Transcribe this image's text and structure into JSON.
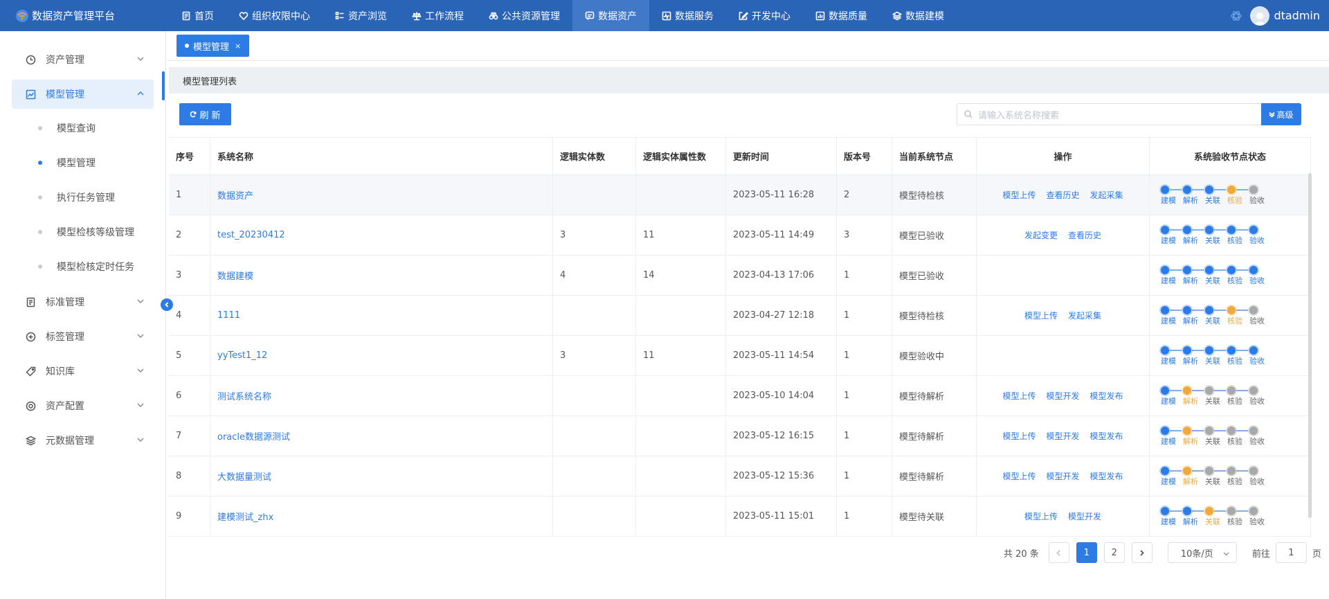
{
  "app": {
    "title": "数据资产管理平台",
    "username": "dtadmin"
  },
  "nav": [
    {
      "label": "首页",
      "icon": "document-icon",
      "active": false
    },
    {
      "label": "组织权限中心",
      "icon": "heart-icon",
      "active": false
    },
    {
      "label": "资产浏览",
      "icon": "list-icon",
      "active": false
    },
    {
      "label": "工作流程",
      "icon": "scale-icon",
      "active": false
    },
    {
      "label": "公共资源管理",
      "icon": "binoculars-icon",
      "active": false
    },
    {
      "label": "数据资产",
      "icon": "chat-icon",
      "active": true
    },
    {
      "label": "数据服务",
      "icon": "pulse-icon",
      "active": false
    },
    {
      "label": "开发中心",
      "icon": "edit-icon",
      "active": false
    },
    {
      "label": "数据质量",
      "icon": "chart-icon",
      "active": false
    },
    {
      "label": "数据建模",
      "icon": "layers-icon",
      "active": false
    }
  ],
  "sidebar": {
    "items": [
      {
        "label": "资产管理",
        "icon": "clock-icon"
      },
      {
        "label": "模型管理",
        "icon": "trend-chart-icon"
      },
      {
        "label": "标准管理",
        "icon": "notebook-icon"
      },
      {
        "label": "标签管理",
        "icon": "plus-circle-icon"
      },
      {
        "label": "知识库",
        "icon": "tag-icon"
      },
      {
        "label": "资产配置",
        "icon": "target-icon"
      },
      {
        "label": "元数据管理",
        "icon": "stack-icon"
      }
    ],
    "subitems": [
      {
        "label": "模型查询",
        "active": false
      },
      {
        "label": "模型管理",
        "active": true
      },
      {
        "label": "执行任务管理",
        "active": false
      },
      {
        "label": "模型检核等级管理",
        "active": false
      },
      {
        "label": "模型检核定时任务",
        "active": false
      }
    ]
  },
  "tabs": [
    {
      "label": "模型管理",
      "close": "×"
    }
  ],
  "panel": {
    "title": "模型管理列表",
    "refresh_label": "刷 新",
    "search_placeholder": "请输入系统名称搜索",
    "advanced_label": "高级"
  },
  "table": {
    "headers": [
      "序号",
      "系统名称",
      "逻辑实体数",
      "逻辑实体属性数",
      "更新时间",
      "版本号",
      "当前系统节点",
      "操作",
      "系统验收节点状态"
    ],
    "step_labels": [
      "建模",
      "解析",
      "关联",
      "核验",
      "验收"
    ],
    "rows": [
      {
        "no": "1",
        "name": "数据资产",
        "entities": "",
        "attrs": "",
        "time": "2023-05-11 16:28",
        "version": "2",
        "node": "模型待检核",
        "ops": [
          "模型上传",
          "查看历史",
          "发起采集"
        ],
        "steps": [
          "done",
          "done",
          "done",
          "current",
          "todo"
        ]
      },
      {
        "no": "2",
        "name": "test_20230412",
        "entities": "3",
        "attrs": "11",
        "time": "2023-05-11 14:49",
        "version": "3",
        "node": "模型已验收",
        "ops": [
          "发起变更",
          "查看历史"
        ],
        "steps": [
          "done",
          "done",
          "done",
          "done",
          "done"
        ]
      },
      {
        "no": "3",
        "name": "数据建模",
        "entities": "4",
        "attrs": "14",
        "time": "2023-04-13 17:06",
        "version": "1",
        "node": "模型已验收",
        "ops": [],
        "steps": [
          "done",
          "done",
          "done",
          "done",
          "done"
        ]
      },
      {
        "no": "4",
        "name": "1111",
        "entities": "",
        "attrs": "",
        "time": "2023-04-27 12:18",
        "version": "1",
        "node": "模型待检核",
        "ops": [
          "模型上传",
          "发起采集"
        ],
        "steps": [
          "done",
          "done",
          "done",
          "current",
          "todo"
        ]
      },
      {
        "no": "5",
        "name": "yyTest1_12",
        "entities": "3",
        "attrs": "11",
        "time": "2023-05-11 14:54",
        "version": "1",
        "node": "模型验收中",
        "ops": [],
        "steps": [
          "done",
          "done",
          "done",
          "done",
          "done"
        ]
      },
      {
        "no": "6",
        "name": "测试系统名称",
        "entities": "",
        "attrs": "",
        "time": "2023-05-10 14:04",
        "version": "1",
        "node": "模型待解析",
        "ops": [
          "模型上传",
          "模型开发",
          "模型发布"
        ],
        "steps": [
          "done",
          "current",
          "todo",
          "todo",
          "todo"
        ]
      },
      {
        "no": "7",
        "name": "oracle数据源测试",
        "entities": "",
        "attrs": "",
        "time": "2023-05-12 16:15",
        "version": "1",
        "node": "模型待解析",
        "ops": [
          "模型上传",
          "模型开发",
          "模型发布"
        ],
        "steps": [
          "done",
          "current",
          "todo",
          "todo",
          "todo"
        ]
      },
      {
        "no": "8",
        "name": "大数据量测试",
        "entities": "",
        "attrs": "",
        "time": "2023-05-12 15:36",
        "version": "1",
        "node": "模型待解析",
        "ops": [
          "模型上传",
          "模型开发",
          "模型发布"
        ],
        "steps": [
          "done",
          "current",
          "todo",
          "todo",
          "todo"
        ]
      },
      {
        "no": "9",
        "name": "建模测试_zhx",
        "entities": "",
        "attrs": "",
        "time": "2023-05-11 15:01",
        "version": "1",
        "node": "模型待关联",
        "ops": [
          "模型上传",
          "模型开发"
        ],
        "steps": [
          "done",
          "done",
          "current",
          "todo",
          "todo"
        ]
      }
    ]
  },
  "pagination": {
    "total": "共 20 条",
    "pages": [
      "1",
      "2"
    ],
    "current": "1",
    "page_size": "10条/页",
    "goto_prefix": "前往",
    "goto_value": "1",
    "goto_suffix": "页"
  },
  "colors": {
    "primary": "#2d7be5",
    "header": "#2a64b7",
    "current": "#f0a93b",
    "todo": "#a9a9a9"
  }
}
